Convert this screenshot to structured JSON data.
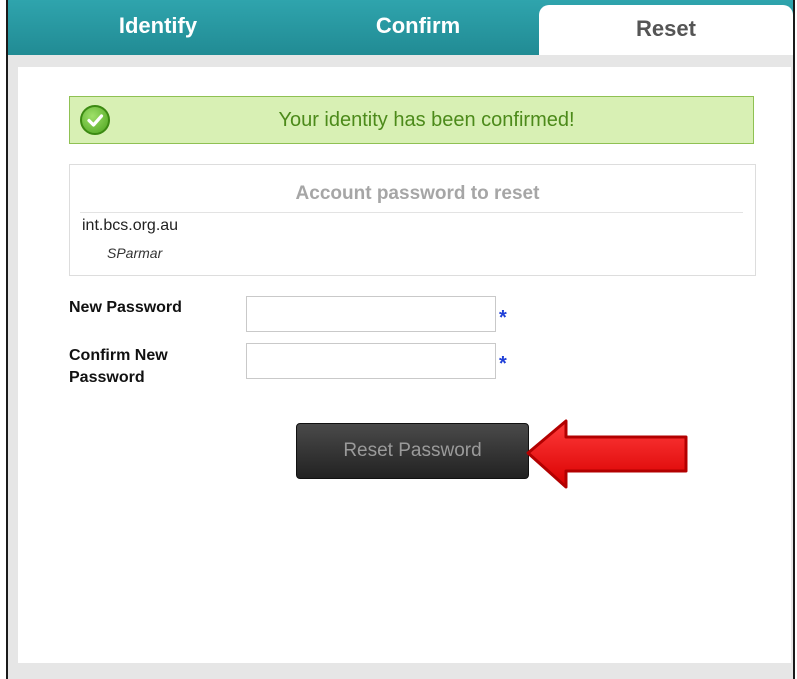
{
  "tabs": [
    {
      "label": "Identify",
      "active": false
    },
    {
      "label": "Confirm",
      "active": false
    },
    {
      "label": "Reset",
      "active": true
    }
  ],
  "success_message": "Your identity has been confirmed!",
  "account": {
    "title": "Account password to reset",
    "domain": "int.bcs.org.au",
    "username": "SParmar"
  },
  "form": {
    "new_password_label": "New Password",
    "confirm_password_label": "Confirm New Password",
    "required_marker": "*"
  },
  "reset_button_label": "Reset Password",
  "colors": {
    "tab_bar": "#2e9aa3",
    "success_bg": "#d8f0b4",
    "success_text": "#4c8a1a",
    "button_bg": "#2a2a2a",
    "arrow": "#ee1a1a"
  }
}
